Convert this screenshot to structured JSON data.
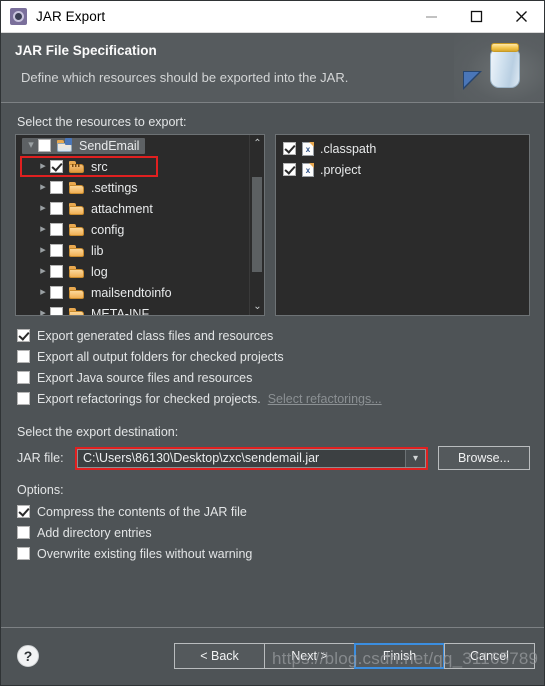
{
  "window": {
    "title": "JAR Export",
    "icon": "eclipse-gear-icon",
    "minimize": "—",
    "maximize": "□",
    "close": "✕"
  },
  "banner": {
    "title": "JAR File Specification",
    "subtitle": "Define which resources should be exported into the JAR.",
    "image": "jar-jar-with-arrow-icon"
  },
  "resources": {
    "label": "Select the resources to export:",
    "tree": [
      {
        "label": "SendEmail",
        "checked": false,
        "selected": true,
        "expanded": true,
        "indent": 0,
        "icon": "project-folder-icon",
        "highlight": false
      },
      {
        "label": "src",
        "checked": true,
        "selected": false,
        "expanded": false,
        "indent": 1,
        "icon": "source-folder-icon",
        "highlight": true
      },
      {
        "label": ".settings",
        "checked": false,
        "selected": false,
        "expanded": false,
        "indent": 1,
        "icon": "folder-icon",
        "highlight": false
      },
      {
        "label": "attachment",
        "checked": false,
        "selected": false,
        "expanded": false,
        "indent": 1,
        "icon": "folder-icon",
        "highlight": false
      },
      {
        "label": "config",
        "checked": false,
        "selected": false,
        "expanded": false,
        "indent": 1,
        "icon": "folder-icon",
        "highlight": false
      },
      {
        "label": "lib",
        "checked": false,
        "selected": false,
        "expanded": false,
        "indent": 1,
        "icon": "folder-icon",
        "highlight": false
      },
      {
        "label": "log",
        "checked": false,
        "selected": false,
        "expanded": false,
        "indent": 1,
        "icon": "folder-icon",
        "highlight": false
      },
      {
        "label": "mailsendtoinfo",
        "checked": false,
        "selected": false,
        "expanded": false,
        "indent": 1,
        "icon": "folder-icon",
        "highlight": false
      },
      {
        "label": "META-INF",
        "checked": false,
        "selected": false,
        "expanded": false,
        "indent": 1,
        "icon": "folder-icon",
        "highlight": false
      }
    ],
    "files": [
      {
        "label": ".classpath",
        "checked": true,
        "icon": "xml-file-icon"
      },
      {
        "label": ".project",
        "checked": true,
        "icon": "xml-file-icon"
      }
    ],
    "scrollbar": {
      "up": "⌃",
      "down": "⌄"
    }
  },
  "export_options": [
    {
      "label": "Export generated class files and resources",
      "checked": true,
      "mnemonic_index": 18
    },
    {
      "label": "Export all output folders for checked projects",
      "checked": false,
      "mnemonic_index": 15
    },
    {
      "label": "Export Java source files and resources",
      "checked": false,
      "mnemonic_index": 12
    },
    {
      "label": "Export refactorings for checked projects.",
      "checked": false,
      "mnemonic_index": 1,
      "link": "Select refactorings..."
    }
  ],
  "destination": {
    "label": "Select the export destination:",
    "jar_file_label": "JAR file:",
    "jar_file_value": "C:\\Users\\86130\\Desktop\\zxc\\sendemail.jar",
    "dropdown_icon": "chevron-down-icon",
    "browse_label": "Browse...",
    "highlight_color": "#e02020"
  },
  "options": {
    "label": "Options:",
    "items": [
      {
        "label": "Compress the contents of the JAR file",
        "checked": true
      },
      {
        "label": "Add directory entries",
        "checked": false
      },
      {
        "label": "Overwrite existing files without warning",
        "checked": false
      }
    ]
  },
  "footer": {
    "help_icon": "?",
    "buttons": [
      {
        "label": "< Back",
        "focused": false,
        "enabled": true
      },
      {
        "label": "Next >",
        "focused": false,
        "enabled": true
      },
      {
        "label": "Finish",
        "focused": true,
        "enabled": true
      },
      {
        "label": "Cancel",
        "focused": false,
        "enabled": true
      }
    ]
  },
  "watermark": "https://blog.csdn.net/qq_31165789"
}
